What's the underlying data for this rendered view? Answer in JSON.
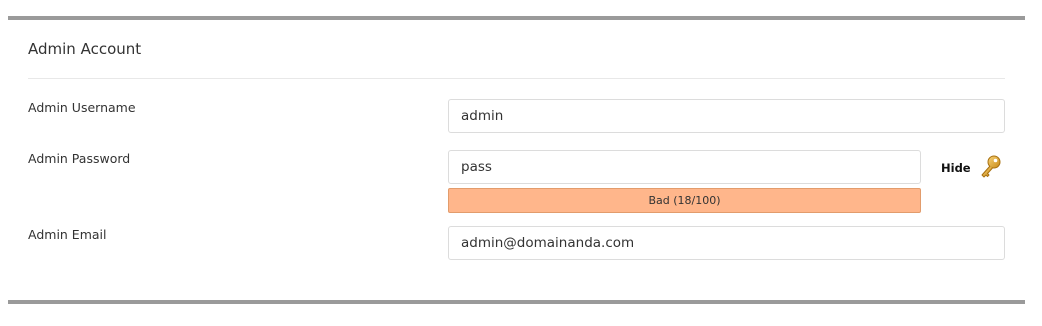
{
  "section": {
    "title": "Admin Account"
  },
  "fields": {
    "username": {
      "label": "Admin Username",
      "value": "admin"
    },
    "password": {
      "label": "Admin Password",
      "value": "pass",
      "toggle_label": "Hide",
      "strength_text": "Bad (18/100)",
      "strength_score": 18,
      "strength_color": "#ffb68b"
    },
    "email": {
      "label": "Admin Email",
      "value": "admin@domainanda.com"
    }
  },
  "icons": {
    "password_generator": "key-icon"
  }
}
